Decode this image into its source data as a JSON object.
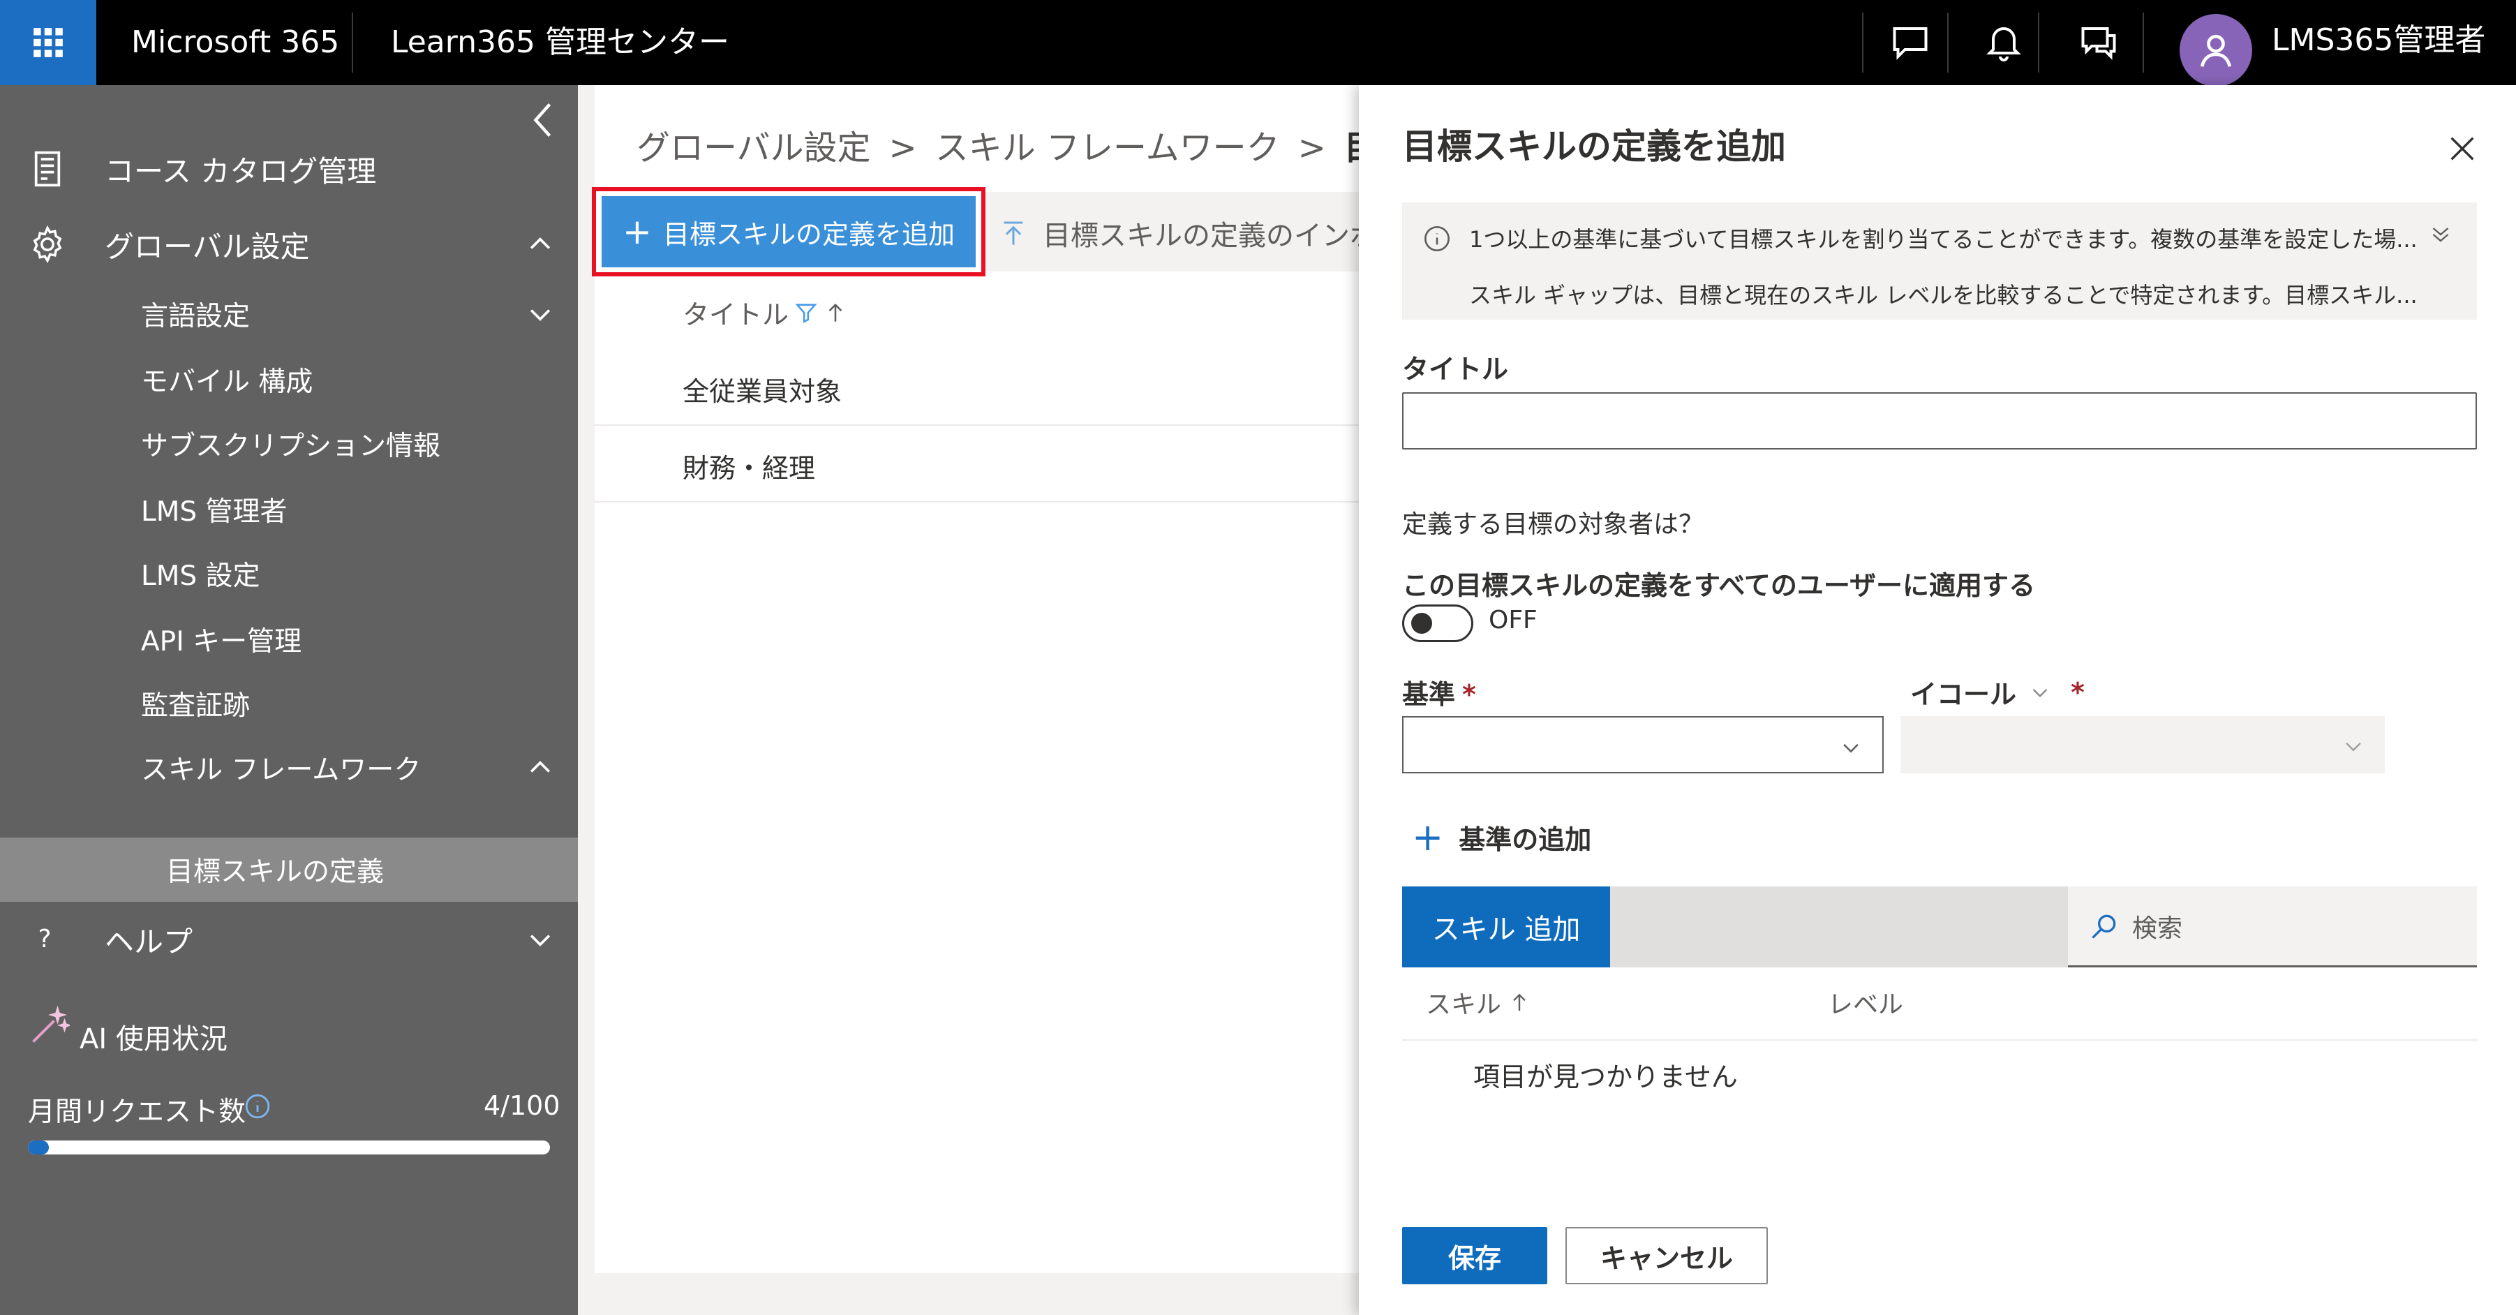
{
  "colors": {
    "topbar": "#000000",
    "waffle_bg": "#1b6ec2",
    "sidebar_bg": "#616161",
    "sidebar_selected": "#8a8a8a",
    "primary": "#0f6cbd",
    "add_button": "#3a8fd9",
    "highlight_border": "#e81123",
    "avatar": "#8764b8"
  },
  "header": {
    "brand": "Microsoft 365",
    "app_title": "Learn365 管理センター",
    "icons": [
      "waffle-icon",
      "chat-icon",
      "bell-icon",
      "feedback-icon"
    ],
    "user_name": "LMS365管理者"
  },
  "sidebar": {
    "items": [
      {
        "label": "コース カタログ管理",
        "icon": "catalog-icon"
      },
      {
        "label": "グローバル設定",
        "icon": "gear-icon",
        "expanded": true
      },
      {
        "label": "言語設定",
        "level": 1
      },
      {
        "label": "モバイル 構成",
        "level": 1
      },
      {
        "label": "サブスクリプション情報",
        "level": 1
      },
      {
        "label": "LMS 管理者",
        "level": 1
      },
      {
        "label": "LMS 設定",
        "level": 1
      },
      {
        "label": "API キー管理",
        "level": 1
      },
      {
        "label": "監査証跡",
        "level": 1
      },
      {
        "label": "スキル フレームワーク",
        "level": 1,
        "expanded": true
      },
      {
        "label": "目標スキルの定義",
        "level": 2,
        "selected": true
      },
      {
        "label": "ヘルプ",
        "icon": "question-icon"
      }
    ],
    "ai_usage": {
      "label": "AI 使用状況",
      "monthly_requests_label": "月間リクエスト数",
      "count_text": "4/100",
      "used": 4,
      "limit": 100
    }
  },
  "main": {
    "breadcrumb": [
      "グローバル設定",
      "スキル フレームワーク",
      "目標"
    ],
    "add_button": "目標スキルの定義を追加",
    "import_button": "目標スキルの定義のインポー",
    "table_header": "タイトル",
    "rows": [
      "全従業員対象",
      "財務・経理"
    ]
  },
  "panel": {
    "title": "目標スキルの定義を追加",
    "info_line1": "1つ以上の基準に基づいて目標スキルを割り当てることができます。複数の基準を設定した場...",
    "info_line2": "スキル ギャップは、目標と現在のスキル レベルを比較することで特定されます。目標スキル...",
    "title_label": "タイトル",
    "title_value": "",
    "audience_question": "定義する目標の対象者は？",
    "apply_all_label": "この目標スキルの定義をすべてのユーザーに適用する",
    "toggle_state": "OFF",
    "criteria_label": "基準",
    "operator_label": "イコール",
    "required_mark": "*",
    "add_criteria": "基準の追加",
    "add_skill_button": "スキル 追加",
    "search_placeholder": "検索",
    "col_skill": "スキル",
    "col_level": "レベル",
    "empty_text": "項目が見つかりません",
    "save": "保存",
    "cancel": "キャンセル"
  }
}
